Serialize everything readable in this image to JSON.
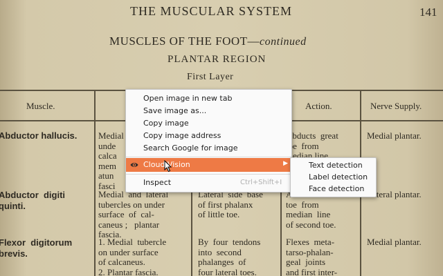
{
  "page": {
    "title": "THE MUSCULAR SYSTEM",
    "page_number": "141",
    "subtitle": "MUSCLES OF THE FOOT—",
    "subtitle_italic": "continued",
    "region": "PLANTAR REGION",
    "layer": "First Layer",
    "columns": [
      "Muscle.",
      "Action.",
      "Nerve Supply."
    ],
    "rows": [
      {
        "muscle": "Abductor hallucis.",
        "origin": "Medial\nunde\ncalca\nmem\natun\nfasci",
        "action": "Abducts  great\ntoe  from\nmedian line",
        "nerve": "Medial plantar."
      },
      {
        "muscle": "Abductor  digiti\nquinti.",
        "origin": "Medial  and  lateral\ntubercles on under\nsurface  of  cal-\ncaneus ;   plantar\nfascia.",
        "insertion": "Lateral  side  base\nof first phalanx\nof little toe.",
        "action": "Abducts  little\ntoe  from\nmedian  line\nof second toe.",
        "nerve": "Lateral plantar."
      },
      {
        "muscle": "Flexor  digitorum\nbrevis.",
        "origin": "1. Medial  tubercle\non under surface\nof calcaneus.\n2. Plantar fascia.",
        "insertion": "By  four  tendons\ninto  second\nphalanges  of\nfour lateral toes.",
        "action": "Flexes  meta-\ntarso-phalan-\ngeal  joints\nand first inter-",
        "nerve": "Medial plantar."
      }
    ]
  },
  "context_menu": {
    "items": [
      {
        "label": "Open image in new tab"
      },
      {
        "label": "Save image as..."
      },
      {
        "label": "Copy image"
      },
      {
        "label": "Copy image address"
      },
      {
        "label": "Search Google for image"
      }
    ],
    "cloud_vision": {
      "label": "Cloud Vision",
      "icon": "eye-icon",
      "highlight": "#ee7a45"
    },
    "inspect": {
      "label": "Inspect",
      "shortcut": "Ctrl+Shift+I"
    }
  },
  "submenu": {
    "items": [
      {
        "label": "Text detection"
      },
      {
        "label": "Label detection"
      },
      {
        "label": "Face detection"
      }
    ]
  }
}
